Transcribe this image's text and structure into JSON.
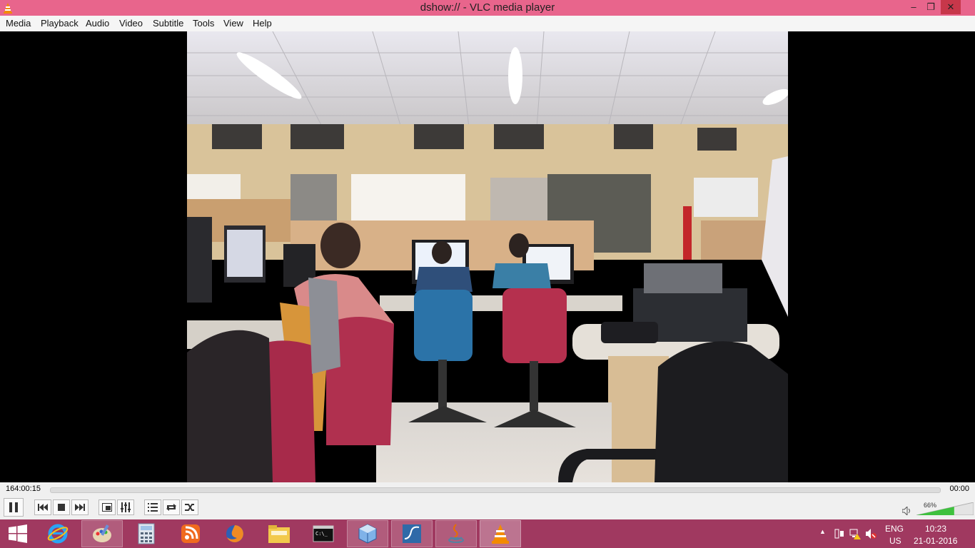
{
  "window": {
    "title": "dshow:// - VLC media player",
    "accent": "#e8658c"
  },
  "menu": [
    {
      "label": "Media"
    },
    {
      "label": "Playback"
    },
    {
      "label": "Audio"
    },
    {
      "label": "Video"
    },
    {
      "label": "Subtitle"
    },
    {
      "label": "Tools"
    },
    {
      "label": "View"
    },
    {
      "label": "Help"
    }
  ],
  "player": {
    "time_elapsed": "164:00:15",
    "time_total": "00:00",
    "volume_percent_label": "66%",
    "volume_level": 0.66
  },
  "controls": [
    {
      "icon": "pause-icon"
    },
    {
      "icon": "previous-icon"
    },
    {
      "icon": "stop-icon"
    },
    {
      "icon": "next-icon"
    },
    {
      "icon": "fullscreen-icon"
    },
    {
      "icon": "extended-settings-icon"
    },
    {
      "icon": "playlist-icon"
    },
    {
      "icon": "loop-icon"
    },
    {
      "icon": "shuffle-icon"
    }
  ],
  "taskbar": {
    "color": "#a03960",
    "apps": [
      {
        "name": "internet-explorer-icon"
      },
      {
        "name": "paint-icon"
      },
      {
        "name": "calculator-icon"
      },
      {
        "name": "network-app-icon"
      },
      {
        "name": "firefox-icon"
      },
      {
        "name": "file-explorer-icon"
      },
      {
        "name": "command-prompt-icon"
      },
      {
        "name": "virtualbox-icon"
      },
      {
        "name": "wireshark-icon"
      },
      {
        "name": "java-icon"
      },
      {
        "name": "vlc-icon"
      }
    ],
    "tray": {
      "lang_top": "ENG",
      "lang_bottom": "US",
      "time": "10:23",
      "date": "21-01-2016"
    }
  }
}
